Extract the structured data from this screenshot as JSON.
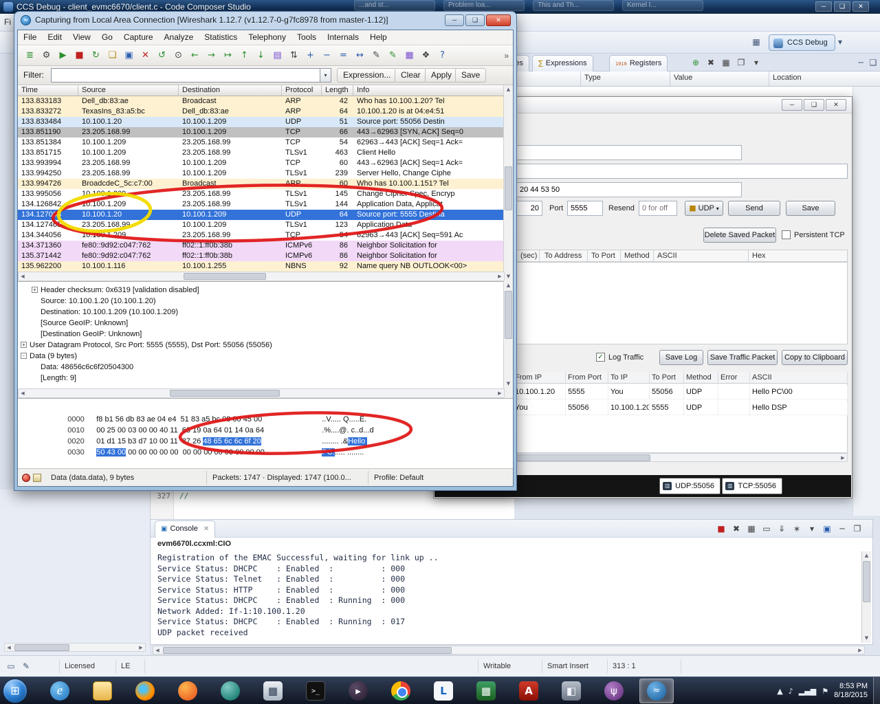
{
  "ccs": {
    "title": "CCS Debug - client_evmc6670/client.c - Code Composer Studio",
    "menu_partial": "Fi",
    "ghost_tabs": [
      "...and st...",
      "Problem loa...",
      "This and Th...",
      "Kernel I..."
    ],
    "perspective_button": "CCS Debug",
    "view_tabs": {
      "variables": "Variables",
      "expressions": "Expressions",
      "registers": "Registers",
      "registers_icon": "1010",
      "expressions_icon": "∑"
    },
    "var_toolbar": [
      {
        "name": "add-expression-icon",
        "glyph": "⊕",
        "cls": "g-green"
      },
      {
        "name": "remove-expression-icon",
        "glyph": "✖",
        "cls": "g-dark"
      },
      {
        "name": "remove-all-expressions-icon",
        "glyph": "▦",
        "cls": "g-dark"
      },
      {
        "name": "copy-variables-icon",
        "glyph": "❐",
        "cls": "g-dark"
      },
      {
        "name": "view-menu-icon",
        "glyph": "▾",
        "cls": "g-dark"
      }
    ],
    "var_columns": [
      "Type",
      "Value",
      "Location"
    ],
    "editor": {
      "line_number": "327",
      "code": "//"
    },
    "console": {
      "tab_label": "Console",
      "target": "evm6670l.ccxml:CIO",
      "toolbar": [
        {
          "name": "terminate-icon",
          "glyph": "■",
          "cls": "g-red"
        },
        {
          "name": "remove-launch-icon",
          "glyph": "✖",
          "cls": "g-dark"
        },
        {
          "name": "remove-all-launches-icon",
          "glyph": "▦",
          "cls": "g-dark"
        },
        {
          "name": "clear-console-icon",
          "glyph": "▭",
          "cls": "g-dark"
        },
        {
          "name": "scroll-lock-icon",
          "glyph": "⇓",
          "cls": "g-dark"
        },
        {
          "name": "pin-console-icon",
          "glyph": "∗",
          "cls": "g-dark"
        },
        {
          "name": "display-console-icon",
          "glyph": "▾",
          "cls": "g-dark"
        },
        {
          "name": "open-console-icon",
          "glyph": "▣",
          "cls": "g-blue"
        },
        {
          "name": "minimize-panel-icon",
          "glyph": "─",
          "cls": "g-dark"
        },
        {
          "name": "maximize-panel-icon",
          "glyph": "❐",
          "cls": "g-dark"
        }
      ],
      "lines": [
        "Registration of the EMAC Successful, waiting for link up ..",
        "Service Status: DHCPC    : Enabled  :          : 000",
        "Service Status: Telnet   : Enabled  :          : 000",
        "Service Status: HTTP     : Enabled  :          : 000",
        "Service Status: DHCPC    : Enabled  : Running  : 000",
        "Network Added: If-1:10.100.1.20",
        "Service Status: DHCPC    : Enabled  : Running  : 017",
        "UDP packet received"
      ]
    },
    "status": {
      "licensed": "Licensed",
      "endianness": "LE",
      "writable": "Writable",
      "insert_mode": "Smart Insert",
      "position": "313 : 1"
    }
  },
  "wireshark": {
    "title": "Capturing from Local Area Connection   [Wireshark 1.12.7  (v1.12.7-0-g7fc8978 from master-1.12)]",
    "menus": [
      "File",
      "Edit",
      "View",
      "Go",
      "Capture",
      "Analyze",
      "Statistics",
      "Telephony",
      "Tools",
      "Internals",
      "Help"
    ],
    "toolbar": [
      {
        "name": "list-interfaces-icon",
        "glyph": "≣",
        "cls": "g-green"
      },
      {
        "name": "capture-options-icon",
        "glyph": "⚙",
        "cls": "g-dark"
      },
      {
        "name": "start-capture-icon",
        "glyph": "▶",
        "cls": "g-green"
      },
      {
        "name": "stop-capture-icon",
        "glyph": "■",
        "cls": "g-red"
      },
      {
        "name": "restart-capture-icon",
        "glyph": "↻",
        "cls": "g-green"
      },
      {
        "name": "open-capture-icon",
        "glyph": "❏",
        "cls": "g-gold"
      },
      {
        "name": "save-capture-icon",
        "glyph": "▣",
        "cls": "g-blue"
      },
      {
        "name": "close-capture-icon",
        "glyph": "✕",
        "cls": "g-red"
      },
      {
        "name": "reload-icon",
        "glyph": "↺",
        "cls": "g-green"
      },
      {
        "name": "find-packet-icon",
        "glyph": "⊙",
        "cls": "g-dark"
      },
      {
        "name": "go-back-icon",
        "glyph": "←",
        "cls": "g-green"
      },
      {
        "name": "go-forward-icon",
        "glyph": "→",
        "cls": "g-green"
      },
      {
        "name": "go-to-packet-icon",
        "glyph": "↦",
        "cls": "g-green"
      },
      {
        "name": "go-top-icon",
        "glyph": "↑",
        "cls": "g-green"
      },
      {
        "name": "go-bottom-icon",
        "glyph": "↓",
        "cls": "g-green"
      },
      {
        "name": "colorize-icon",
        "glyph": "▤",
        "cls": "g-purple"
      },
      {
        "name": "autoscroll-icon",
        "glyph": "⇅",
        "cls": "g-dark"
      },
      {
        "name": "zoom-in-icon",
        "glyph": "+",
        "cls": "g-blue"
      },
      {
        "name": "zoom-out-icon",
        "glyph": "−",
        "cls": "g-blue"
      },
      {
        "name": "zoom-100-icon",
        "glyph": "=",
        "cls": "g-blue"
      },
      {
        "name": "resize-columns-icon",
        "glyph": "↔",
        "cls": "g-blue"
      },
      {
        "name": "capture-filters-icon",
        "glyph": "✎",
        "cls": "g-dark"
      },
      {
        "name": "display-filters-icon",
        "glyph": "✎",
        "cls": "g-green"
      },
      {
        "name": "coloring-rules-icon",
        "glyph": "▦",
        "cls": "g-purple"
      },
      {
        "name": "preferences-icon",
        "glyph": "❖",
        "cls": "g-dark"
      },
      {
        "name": "help-icon",
        "glyph": "?",
        "cls": "g-blue"
      }
    ],
    "overflow": "»",
    "filter": {
      "label": "Filter:",
      "value": "",
      "expression_button": "Expression...",
      "clear_button": "Clear",
      "apply_button": "Apply",
      "save_button": "Save"
    },
    "columns": [
      "Time",
      "Source",
      "Destination",
      "Protocol",
      "Length",
      "Info"
    ],
    "packets": [
      {
        "time": "133.833183",
        "source": "Dell_db:83:ae",
        "destination": "Broadcast",
        "protocol": "ARP",
        "length": "42",
        "info": "Who has 10.100.1.20?  Tel",
        "cls": "r-arp"
      },
      {
        "time": "133.833272",
        "source": "TexasIns_83:a5:bc",
        "destination": "Dell_db:83:ae",
        "protocol": "ARP",
        "length": "64",
        "info": "10.100.1.20 is at 04:e4:51",
        "cls": "r-arp"
      },
      {
        "time": "133.833484",
        "source": "10.100.1.20",
        "destination": "10.100.1.209",
        "protocol": "UDP",
        "length": "51",
        "info": "Source port: 55056  Destin",
        "cls": "r-udp"
      },
      {
        "time": "133.851190",
        "source": "23.205.168.99",
        "destination": "10.100.1.209",
        "protocol": "TCP",
        "length": "66",
        "info": "443→62963 [SYN, ACK] Seq=0",
        "cls": "r-gray"
      },
      {
        "time": "133.851384",
        "source": "10.100.1.209",
        "destination": "23.205.168.99",
        "protocol": "TCP",
        "length": "54",
        "info": "62963→443 [ACK] Seq=1 Ack=",
        "cls": "r-plain"
      },
      {
        "time": "133.851715",
        "source": "10.100.1.209",
        "destination": "23.205.168.99",
        "protocol": "TLSv1",
        "length": "463",
        "info": "Client Hello",
        "cls": "r-plain"
      },
      {
        "time": "133.993994",
        "source": "23.205.168.99",
        "destination": "10.100.1.209",
        "protocol": "TCP",
        "length": "60",
        "info": "443→62963 [ACK] Seq=1 Ack=",
        "cls": "r-plain"
      },
      {
        "time": "133.994250",
        "source": "23.205.168.99",
        "destination": "10.100.1.209",
        "protocol": "TLSv1",
        "length": "239",
        "info": "Server Hello, Change Ciphe",
        "cls": "r-plain"
      },
      {
        "time": "133.994726",
        "source": "BroadcdeC_5c:c7:00",
        "destination": "Broadcast",
        "protocol": "ARP",
        "length": "60",
        "info": "Who has 10.100.1.151?  Tel",
        "cls": "r-arp"
      },
      {
        "time": "133.995056",
        "source": "10.100.1.209",
        "destination": "23.205.168.99",
        "protocol": "TLSv1",
        "length": "145",
        "info": "Change Cipher Spec, Encryp",
        "cls": "r-plain"
      },
      {
        "time": "134.126842",
        "source": "10.100.1.209",
        "destination": "23.205.168.99",
        "protocol": "TLSv1",
        "length": "144",
        "info": "Application Data, Applicat",
        "cls": "r-plain"
      },
      {
        "time": "134.127063",
        "source": "10.100.1.20",
        "destination": "10.100.1.209",
        "protocol": "UDP",
        "length": "64",
        "info": "Source port: 5555  Destina",
        "cls": "r-sel"
      },
      {
        "time": "134.127465",
        "source": "23.205.168.99",
        "destination": "10.100.1.209",
        "protocol": "TLSv1",
        "length": "123",
        "info": "Application Data",
        "cls": "r-plain"
      },
      {
        "time": "134.344056",
        "source": "10.100.1.209",
        "destination": "23.205.168.99",
        "protocol": "TCP",
        "length": "54",
        "info": "62963→443 [ACK] Seq=591 Ac",
        "cls": "r-plain"
      },
      {
        "time": "134.371360",
        "source": "fe80::9d92:c047:762",
        "destination": "ff02::1:ff0b:38b",
        "protocol": "ICMPv6",
        "length": "86",
        "info": "Neighbor Solicitation for",
        "cls": "r-icmp"
      },
      {
        "time": "135.371442",
        "source": "fe80::9d92:c047:762",
        "destination": "ff02::1:ff0b:38b",
        "protocol": "ICMPv6",
        "length": "86",
        "info": "Neighbor Solicitation for",
        "cls": "r-icmp"
      },
      {
        "time": "135.962200",
        "source": "10.100.1.116",
        "destination": "10.100.1.255",
        "protocol": "NBNS",
        "length": "92",
        "info": "Name query NB OUTLOOK<00>",
        "cls": "r-arp"
      }
    ],
    "details": [
      {
        "exp": "+",
        "ind": "i1",
        "text": "Header checksum: 0x6319 [validation disabled]"
      },
      {
        "exp": "",
        "ind": "i1",
        "text": "Source: 10.100.1.20 (10.100.1.20)"
      },
      {
        "exp": "",
        "ind": "i1",
        "text": "Destination: 10.100.1.209 (10.100.1.209)"
      },
      {
        "exp": "",
        "ind": "i1",
        "text": "[Source GeoIP: Unknown]"
      },
      {
        "exp": "",
        "ind": "i1",
        "text": "[Destination GeoIP: Unknown]"
      },
      {
        "exp": "+",
        "ind": "i0",
        "text": "User Datagram Protocol, Src Port: 5555 (5555), Dst Port: 55056 (55056)"
      },
      {
        "exp": "-",
        "ind": "i0",
        "text": "Data (9 bytes)"
      },
      {
        "exp": "",
        "ind": "i1",
        "text": "Data: 48656c6c6f20504300"
      },
      {
        "exp": "",
        "ind": "i1",
        "text": "[Length: 9]"
      }
    ],
    "hex": [
      {
        "offset": "0000",
        "pre": "f8 b1 56 db 83 ae 04 e4  51 83 a5 bc 08 00 45 00",
        "sel": "",
        "post": "",
        "apre": "..V..... Q.....E.",
        "asel": "",
        "apost": ""
      },
      {
        "offset": "0010",
        "pre": "00 25 00 03 00 00 40 11  63 19 0a 64 01 14 0a 64",
        "sel": "",
        "post": "",
        "apre": ".%....@. c..d...d",
        "asel": "",
        "apost": ""
      },
      {
        "offset": "0020",
        "pre": "01 d1 15 b3 d7 10 00 11  87 26 ",
        "sel": "48 65 6c 6c 6f 20",
        "post": "",
        "apre": "........ .&",
        "asel": "Hello ",
        "apost": ""
      },
      {
        "offset": "0030",
        "pre": "",
        "sel": "50 43 00",
        "post": " 00 00 00 00 00  00 00 00 00 00 00 00 00",
        "apre": "",
        "asel": "PC.",
        "apost": "..... ........"
      }
    ],
    "status": {
      "selected_field": "Data (data.data), 9 bytes",
      "packets_info": "Packets: 1747 · Displayed: 1747 (100.0...",
      "profile": "Profile: Default"
    }
  },
  "packet_sender": {
    "address_value": "20",
    "ascii_field_value": "",
    "name_field_value": "",
    "hex_field_value": "20 44 53 50",
    "port_label": "Port",
    "port_value": "5555",
    "resend_label": "Resend",
    "resend_placeholder": "0 for off",
    "protocol_value": "UDP",
    "send_label": "Send",
    "save_label": "Save",
    "delete_saved_label": "Delete Saved Packet",
    "persistent_tcp_label": "Persistent TCP",
    "queue_columns": [
      "(sec)",
      "To Address",
      "To Port",
      "Method",
      "ASCII",
      "Hex"
    ],
    "log_traffic_label": "Log Traffic",
    "save_log_label": "Save Log",
    "save_traffic_label": "Save Traffic Packet",
    "copy_clipboard_label": "Copy to Clipboard",
    "log_columns": [
      "From IP",
      "From Port",
      "To IP",
      "To Port",
      "Method",
      "Error",
      "ASCII"
    ],
    "log_rows": [
      [
        "10.100.1.20",
        "5555",
        "You",
        "55056",
        "UDP",
        "",
        "Hello PC\\00"
      ],
      [
        "You",
        "55056",
        "10.100.1.20",
        "5555",
        "UDP",
        "",
        "Hello DSP"
      ]
    ],
    "udp_button": "UDP:55056",
    "tcp_button": "TCP:55056"
  },
  "taskbar": {
    "icons": [
      {
        "name": "taskbar-ie",
        "glyph": "e",
        "cls": "ic-ie"
      },
      {
        "name": "taskbar-explorer",
        "glyph": "",
        "cls": "ic-folder"
      },
      {
        "name": "taskbar-firefox",
        "glyph": "",
        "cls": "ic-firefox"
      },
      {
        "name": "taskbar-app-orange",
        "glyph": "",
        "cls": "ic-orange"
      },
      {
        "name": "taskbar-app-teal",
        "glyph": "",
        "cls": "ic-teal"
      },
      {
        "name": "taskbar-calculator",
        "glyph": "▦",
        "cls": "ic-calc"
      },
      {
        "name": "taskbar-cmd",
        "glyph": ">_",
        "cls": "ic-cmd"
      },
      {
        "name": "taskbar-app-dark",
        "glyph": "▸",
        "cls": "ic-dark"
      },
      {
        "name": "taskbar-chrome",
        "glyph": "",
        "cls": "ic-chrome"
      },
      {
        "name": "taskbar-labview",
        "glyph": "L",
        "cls": "ic-lv"
      },
      {
        "name": "taskbar-app-green",
        "glyph": "▦",
        "cls": "ic-green"
      },
      {
        "name": "taskbar-adobe",
        "glyph": "A",
        "cls": "ic-adobe"
      },
      {
        "name": "taskbar-ccs",
        "glyph": "◧",
        "cls": "ic-ccs"
      },
      {
        "name": "taskbar-wifi",
        "glyph": "ψ",
        "cls": "ic-wifi"
      },
      {
        "name": "taskbar-wireshark",
        "glyph": "≈",
        "cls": "ic-ws active"
      }
    ],
    "tray": {
      "time": "8:53 PM",
      "date": "8/18/2015"
    }
  }
}
